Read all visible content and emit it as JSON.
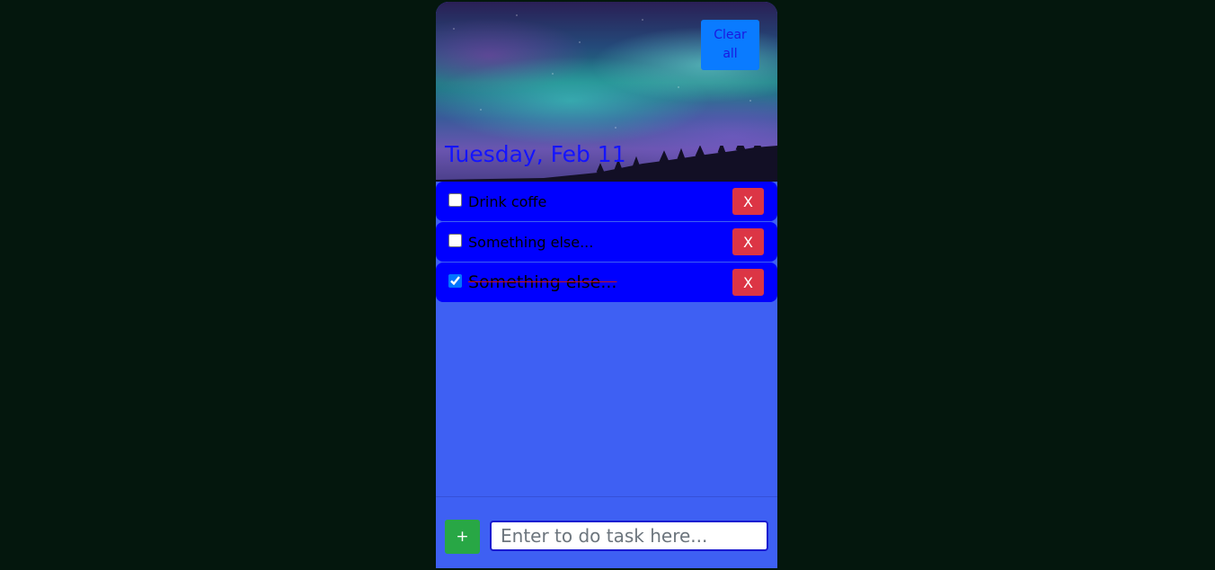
{
  "header": {
    "clear_label": "Clear all",
    "date": "Tuesday, Feb 11"
  },
  "tasks": [
    {
      "label": "Drink coffe",
      "done": false,
      "delete_label": "X"
    },
    {
      "label": "Something else...",
      "done": false,
      "delete_label": "X"
    },
    {
      "label": "Something else...",
      "done": true,
      "delete_label": "X"
    }
  ],
  "footer": {
    "add_label": "+",
    "input_placeholder": "Enter to do task here...",
    "input_value": ""
  },
  "colors": {
    "page_bg": "#04170d",
    "app_bg": "#3e60f3",
    "task_bg": "#0000ff",
    "date_text": "#1414ff",
    "clear_button": "#0a7bff",
    "delete_button": "#dc3545",
    "add_button": "#28a745"
  },
  "icons": {
    "hero": "aurora-night-sky-image"
  }
}
